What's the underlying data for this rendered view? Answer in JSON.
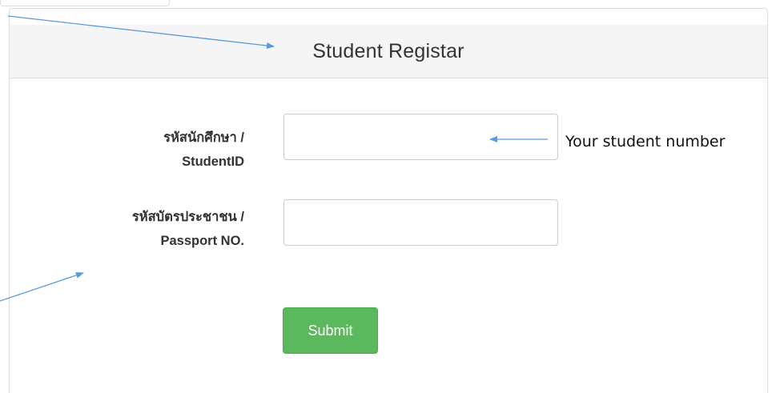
{
  "form": {
    "title": "Student Registar",
    "fields": [
      {
        "label_line1": "รหัสนักศึกษา /",
        "label_line2": "StudentID",
        "value": "",
        "placeholder": ""
      },
      {
        "label_line1": "รหัสบัตรประชาชน /",
        "label_line2": "Passport NO.",
        "value": "",
        "placeholder": ""
      }
    ],
    "submit_label": "Submit"
  },
  "annotations": {
    "student_number_note": "Your student number"
  },
  "colors": {
    "heading_background": "#f5f5f5",
    "submit_green": "#5cb85c",
    "arrow_blue": "#5b9bd5",
    "border": "#dddddd"
  }
}
